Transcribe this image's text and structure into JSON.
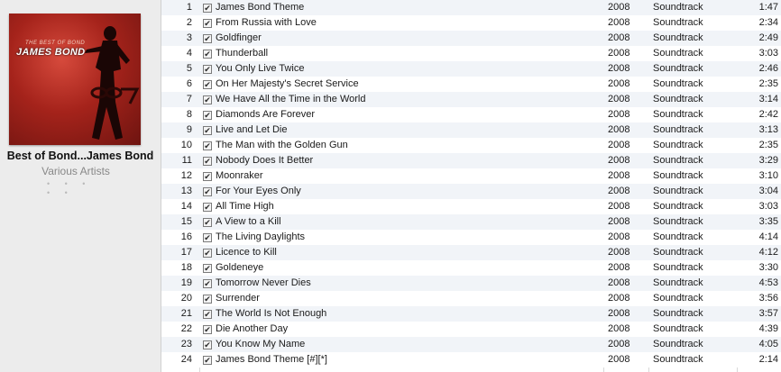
{
  "album": {
    "title": "Best of Bond...James Bond",
    "artist": "Various Artists",
    "rating": "• • • • •",
    "art_subtitle": "THE BEST OF BOND",
    "art_title": "JAMES BOND",
    "art_badge": "007"
  },
  "tracks": [
    {
      "num": "1",
      "checked": "✔",
      "name": "James Bond Theme",
      "year": "2008",
      "genre": "Soundtrack",
      "time": "1:47"
    },
    {
      "num": "2",
      "checked": "✔",
      "name": "From Russia with Love",
      "year": "2008",
      "genre": "Soundtrack",
      "time": "2:34"
    },
    {
      "num": "3",
      "checked": "✔",
      "name": "Goldfinger",
      "year": "2008",
      "genre": "Soundtrack",
      "time": "2:49"
    },
    {
      "num": "4",
      "checked": "✔",
      "name": "Thunderball",
      "year": "2008",
      "genre": "Soundtrack",
      "time": "3:03"
    },
    {
      "num": "5",
      "checked": "✔",
      "name": "You Only Live Twice",
      "year": "2008",
      "genre": "Soundtrack",
      "time": "2:46"
    },
    {
      "num": "6",
      "checked": "✔",
      "name": "On Her Majesty's Secret Service",
      "year": "2008",
      "genre": "Soundtrack",
      "time": "2:35"
    },
    {
      "num": "7",
      "checked": "✔",
      "name": "We Have All the Time in the World",
      "year": "2008",
      "genre": "Soundtrack",
      "time": "3:14"
    },
    {
      "num": "8",
      "checked": "✔",
      "name": "Diamonds Are Forever",
      "year": "2008",
      "genre": "Soundtrack",
      "time": "2:42"
    },
    {
      "num": "9",
      "checked": "✔",
      "name": "Live and Let Die",
      "year": "2008",
      "genre": "Soundtrack",
      "time": "3:13"
    },
    {
      "num": "10",
      "checked": "✔",
      "name": "The Man with the Golden Gun",
      "year": "2008",
      "genre": "Soundtrack",
      "time": "2:35"
    },
    {
      "num": "11",
      "checked": "✔",
      "name": "Nobody Does It Better",
      "year": "2008",
      "genre": "Soundtrack",
      "time": "3:29"
    },
    {
      "num": "12",
      "checked": "✔",
      "name": "Moonraker",
      "year": "2008",
      "genre": "Soundtrack",
      "time": "3:10"
    },
    {
      "num": "13",
      "checked": "✔",
      "name": "For Your Eyes Only",
      "year": "2008",
      "genre": "Soundtrack",
      "time": "3:04"
    },
    {
      "num": "14",
      "checked": "✔",
      "name": "All Time High",
      "year": "2008",
      "genre": "Soundtrack",
      "time": "3:03"
    },
    {
      "num": "15",
      "checked": "✔",
      "name": "A View to a Kill",
      "year": "2008",
      "genre": "Soundtrack",
      "time": "3:35"
    },
    {
      "num": "16",
      "checked": "✔",
      "name": "The Living Daylights",
      "year": "2008",
      "genre": "Soundtrack",
      "time": "4:14"
    },
    {
      "num": "17",
      "checked": "✔",
      "name": "Licence to Kill",
      "year": "2008",
      "genre": "Soundtrack",
      "time": "4:12"
    },
    {
      "num": "18",
      "checked": "✔",
      "name": "Goldeneye",
      "year": "2008",
      "genre": "Soundtrack",
      "time": "3:30"
    },
    {
      "num": "19",
      "checked": "✔",
      "name": "Tomorrow Never Dies",
      "year": "2008",
      "genre": "Soundtrack",
      "time": "4:53"
    },
    {
      "num": "20",
      "checked": "✔",
      "name": "Surrender",
      "year": "2008",
      "genre": "Soundtrack",
      "time": "3:56"
    },
    {
      "num": "21",
      "checked": "✔",
      "name": "The World Is Not Enough",
      "year": "2008",
      "genre": "Soundtrack",
      "time": "3:57"
    },
    {
      "num": "22",
      "checked": "✔",
      "name": "Die Another Day",
      "year": "2008",
      "genre": "Soundtrack",
      "time": "4:39"
    },
    {
      "num": "23",
      "checked": "✔",
      "name": "You Know My Name",
      "year": "2008",
      "genre": "Soundtrack",
      "time": "4:05"
    },
    {
      "num": "24",
      "checked": "✔",
      "name": "James Bond Theme [#][*]",
      "year": "2008",
      "genre": "Soundtrack",
      "time": "2:14"
    }
  ]
}
